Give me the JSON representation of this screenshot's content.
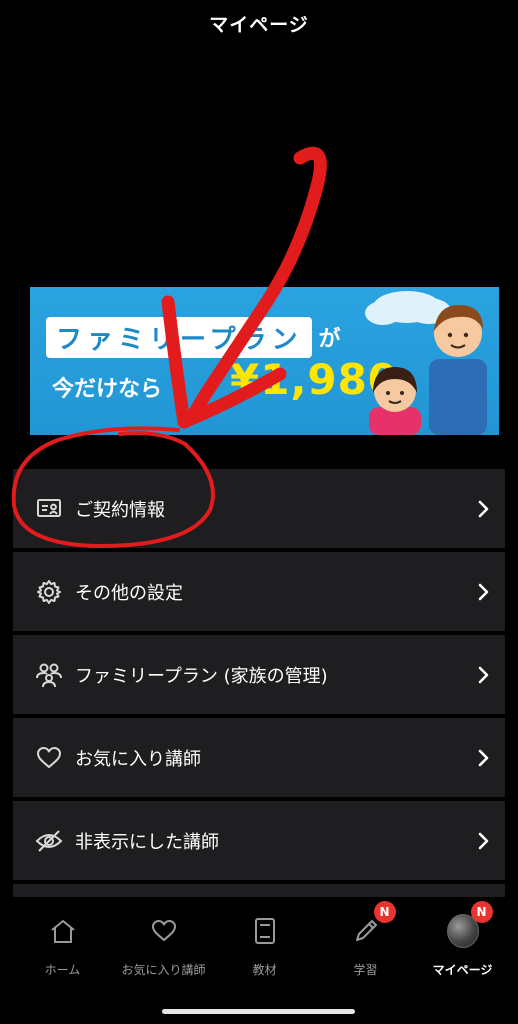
{
  "header": {
    "title": "マイページ"
  },
  "banner": {
    "headline": "ファミリープラン",
    "headline_suffix": "が",
    "subline": "今だけなら",
    "price": "¥1,980"
  },
  "menu": {
    "items": [
      {
        "label": "ご契約情報",
        "icon": "contract-card-icon"
      },
      {
        "label": "その他の設定",
        "icon": "gear-icon"
      },
      {
        "label": "ファミリープラン (家族の管理)",
        "icon": "family-icon"
      },
      {
        "label": "お気に入り講師",
        "icon": "heart-icon"
      },
      {
        "label": "非表示にした講師",
        "icon": "eye-slash-icon"
      }
    ]
  },
  "tabbar": {
    "tabs": [
      {
        "label": "ホーム",
        "icon": "home-icon"
      },
      {
        "label": "お気に入り講師",
        "icon": "heart-icon"
      },
      {
        "label": "教材",
        "icon": "book-icon"
      },
      {
        "label": "学習",
        "icon": "pencil-icon",
        "badge": "N"
      },
      {
        "label": "マイページ",
        "icon": "avatar",
        "badge": "N",
        "active": true
      }
    ]
  },
  "colors": {
    "background": "#000000",
    "menu_row": "#1e1d1f",
    "badge": "#e8332f",
    "banner_blue": "#2aa3e0",
    "price_yellow": "#ffe500",
    "annotation_red": "#e21c1c"
  }
}
